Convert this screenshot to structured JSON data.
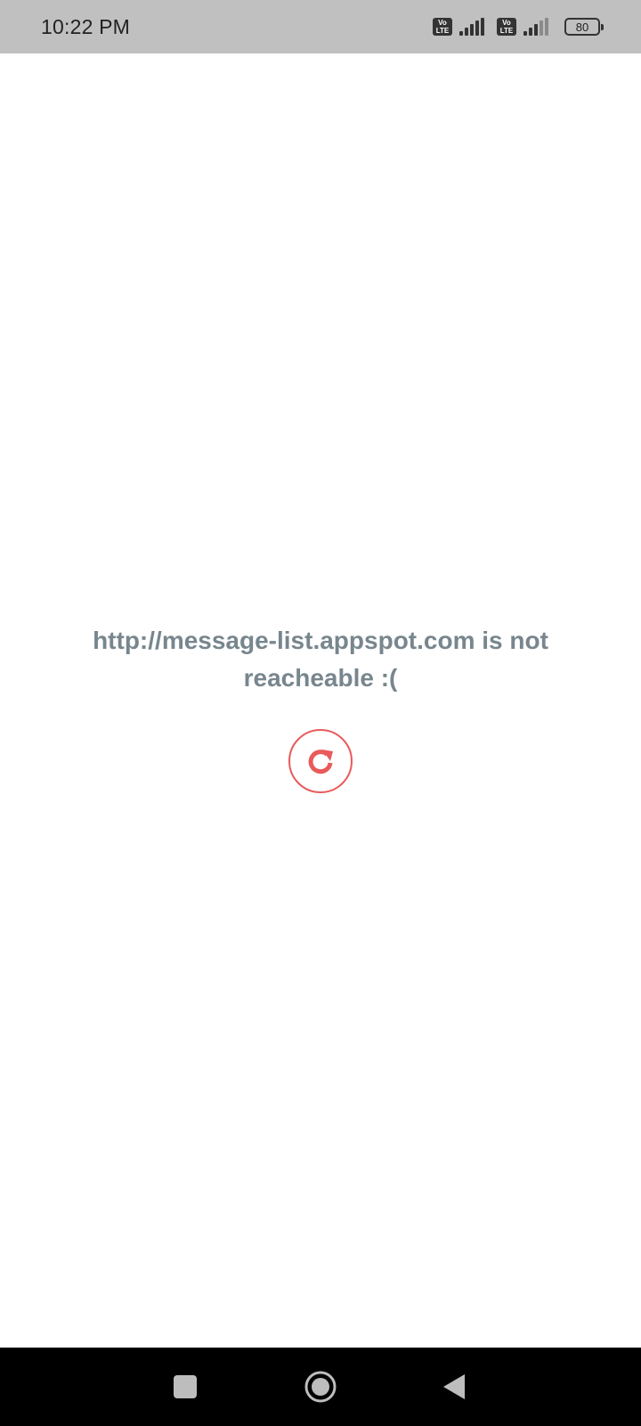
{
  "status_bar": {
    "time": "10:22 PM",
    "sim1_badge": "Vo LTE",
    "sim2_badge": "Vo LTE",
    "battery_level": "80"
  },
  "main": {
    "error_message": "http://message-list.appspot.com is not reacheable :(",
    "reload_icon": "reload-icon",
    "accent_color": "#e85b5b",
    "text_color": "#78868e"
  },
  "nav_bar": {
    "recents_icon": "square-icon",
    "home_icon": "circle-icon",
    "back_icon": "triangle-back-icon"
  }
}
